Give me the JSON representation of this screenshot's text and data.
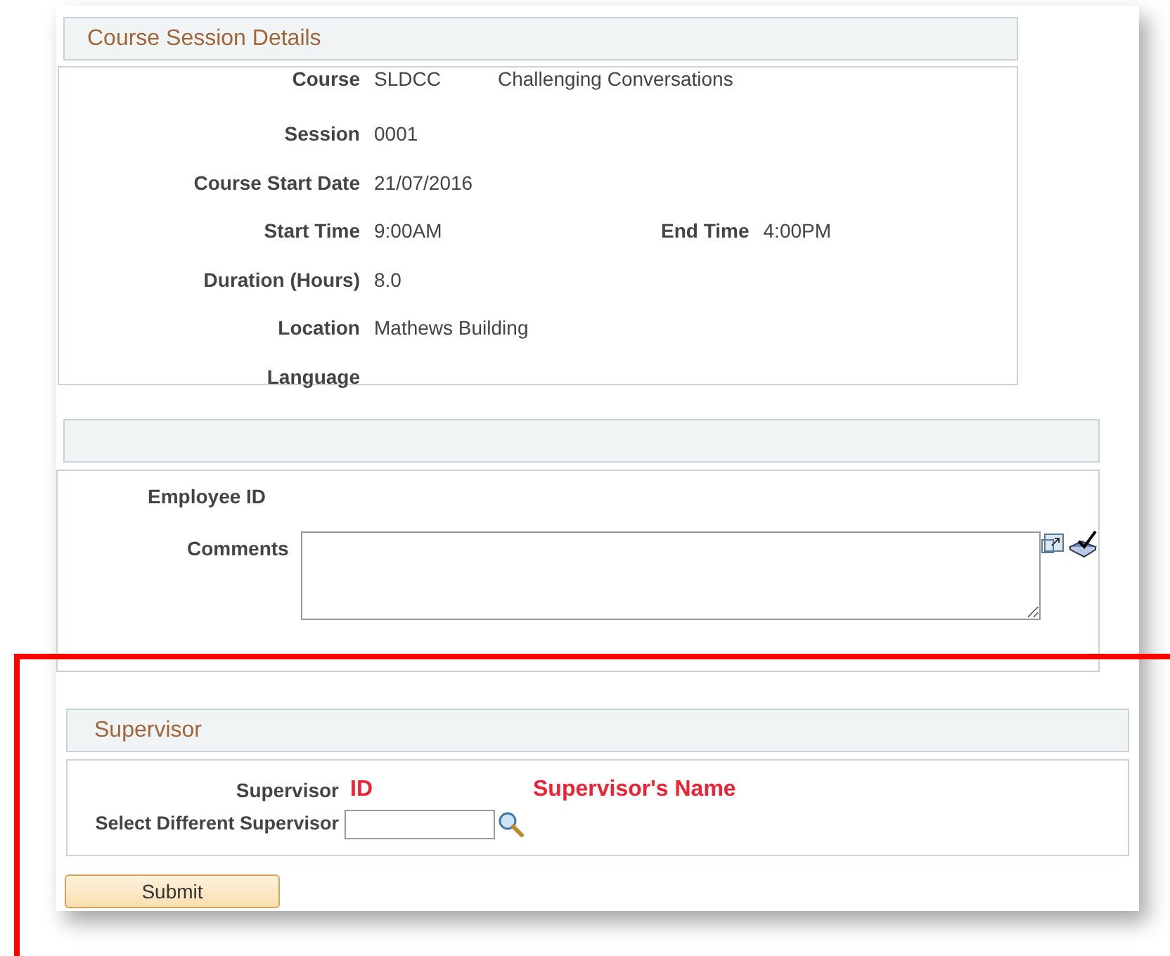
{
  "course_section": {
    "title": "Course Session Details",
    "course": {
      "label": "Course",
      "code": "SLDCC",
      "name": "Challenging Conversations"
    },
    "fields": [
      {
        "label": "Session",
        "value": "0001"
      },
      {
        "label": "Course Start Date",
        "value": "21/07/2016"
      }
    ],
    "times": {
      "start_label": "Start Time",
      "start": "9:00AM",
      "end_label": "End Time",
      "end": "4:00PM"
    },
    "more_fields": [
      {
        "label": "Duration (Hours)",
        "value": "8.0"
      },
      {
        "label": "Location",
        "value": "Mathews Building"
      },
      {
        "label": "Language"
      }
    ]
  },
  "employee_section": {
    "employee_id_label": "Employee ID",
    "comments_label": "Comments"
  },
  "supervisor_section": {
    "title": "Supervisor",
    "supervisor_label": "Supervisor",
    "supervisor_id": "ID",
    "supervisor_name": "Supervisor's Name",
    "select_label": "Select Different Supervisor"
  },
  "submit_button": "Submit"
}
